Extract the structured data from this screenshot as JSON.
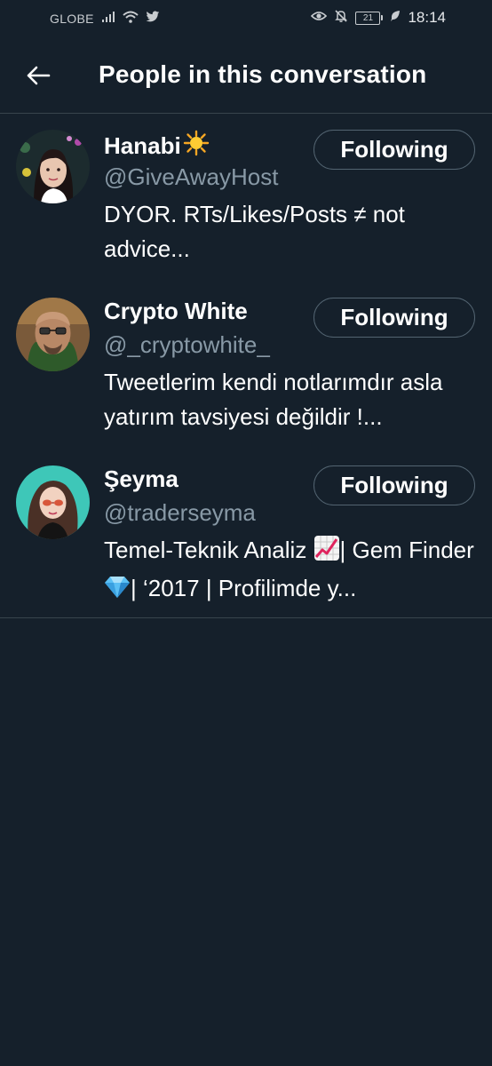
{
  "status_bar": {
    "carrier": "GLOBE",
    "battery": "21",
    "time": "18:14",
    "icons": [
      "signal-icon",
      "wifi-icon",
      "twitter-bird-icon",
      "eye-icon",
      "bell-off-icon",
      "battery-icon",
      "leaf-icon"
    ]
  },
  "header": {
    "title": "People in this conversation",
    "back_icon": "arrow-left-icon"
  },
  "people": [
    {
      "name": "Hanabi",
      "name_emoji": "sun-emoji",
      "handle": "@GiveAwayHost",
      "bio_text": "DYOR. RTs/Likes/Posts ≠ not advice...",
      "button_label": "Following"
    },
    {
      "name": "Crypto White",
      "handle": "@_cryptowhite_",
      "bio_text": "Tweetlerim kendi notlarımdır asla yatırım tavsiyesi değildir !...",
      "button_label": "Following"
    },
    {
      "name": "Şeyma",
      "handle": "@traderseyma",
      "bio_part1": "Temel-Teknik Analiz ",
      "bio_part2": "| Gem Finder ",
      "bio_part3": "| ‘2017 | Profilimde y...",
      "button_label": "Following"
    }
  ],
  "colors": {
    "background": "#15202b",
    "divider": "#38444d",
    "secondary_text": "#8899a6",
    "button_border": "#536471"
  }
}
